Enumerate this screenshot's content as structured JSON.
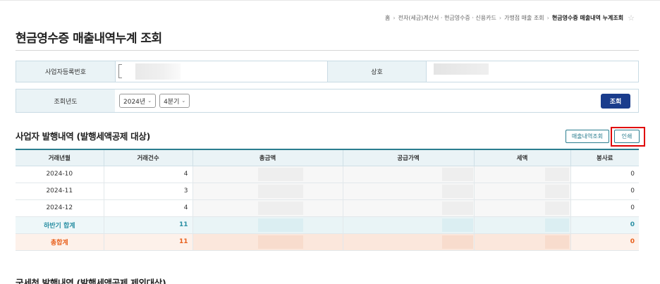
{
  "breadcrumb": {
    "items": [
      "홈",
      "전자(세금)계산서 · 현금영수증 · 신용카드",
      "가맹점 매출 조회"
    ],
    "current": "현금영수증 매출내역 누계조회"
  },
  "page_title": "현금영수증 매출내역누계 조회",
  "info": {
    "biz_no_label": "사업자등록번호",
    "company_label": "상호"
  },
  "query": {
    "year_label": "조회년도",
    "year_value": "2024년",
    "quarter_value": "4분기",
    "search_button": "조회"
  },
  "section1": {
    "title": "사업자 발행내역 (발행세액공제 대상)",
    "detail_button": "매출내역조회",
    "print_button": "인쇄"
  },
  "table": {
    "headers": [
      "거래년월",
      "거래건수",
      "총금액",
      "공급가액",
      "세액",
      "봉사료"
    ],
    "rows": [
      {
        "month": "2024-10",
        "count": "4",
        "service": "0"
      },
      {
        "month": "2024-11",
        "count": "3",
        "service": "0"
      },
      {
        "month": "2024-12",
        "count": "4",
        "service": "0"
      }
    ],
    "subtotal": {
      "label": "하반기 합계",
      "count": "11",
      "service": "0"
    },
    "total": {
      "label": "총합계",
      "count": "11",
      "service": "0"
    }
  },
  "section2": {
    "title": "국세청 발행내역 (발행세액공제 제외대상)"
  },
  "colors": {
    "accent": "#2a7d8f",
    "button_navy": "#1a3c8c",
    "highlight_red": "#e00000",
    "total_orange": "#e8601c"
  },
  "icons": {
    "favorite": "star-icon",
    "dropdown": "chevron-down-icon",
    "breadcrumb_sep": "chevron-right-icon"
  }
}
